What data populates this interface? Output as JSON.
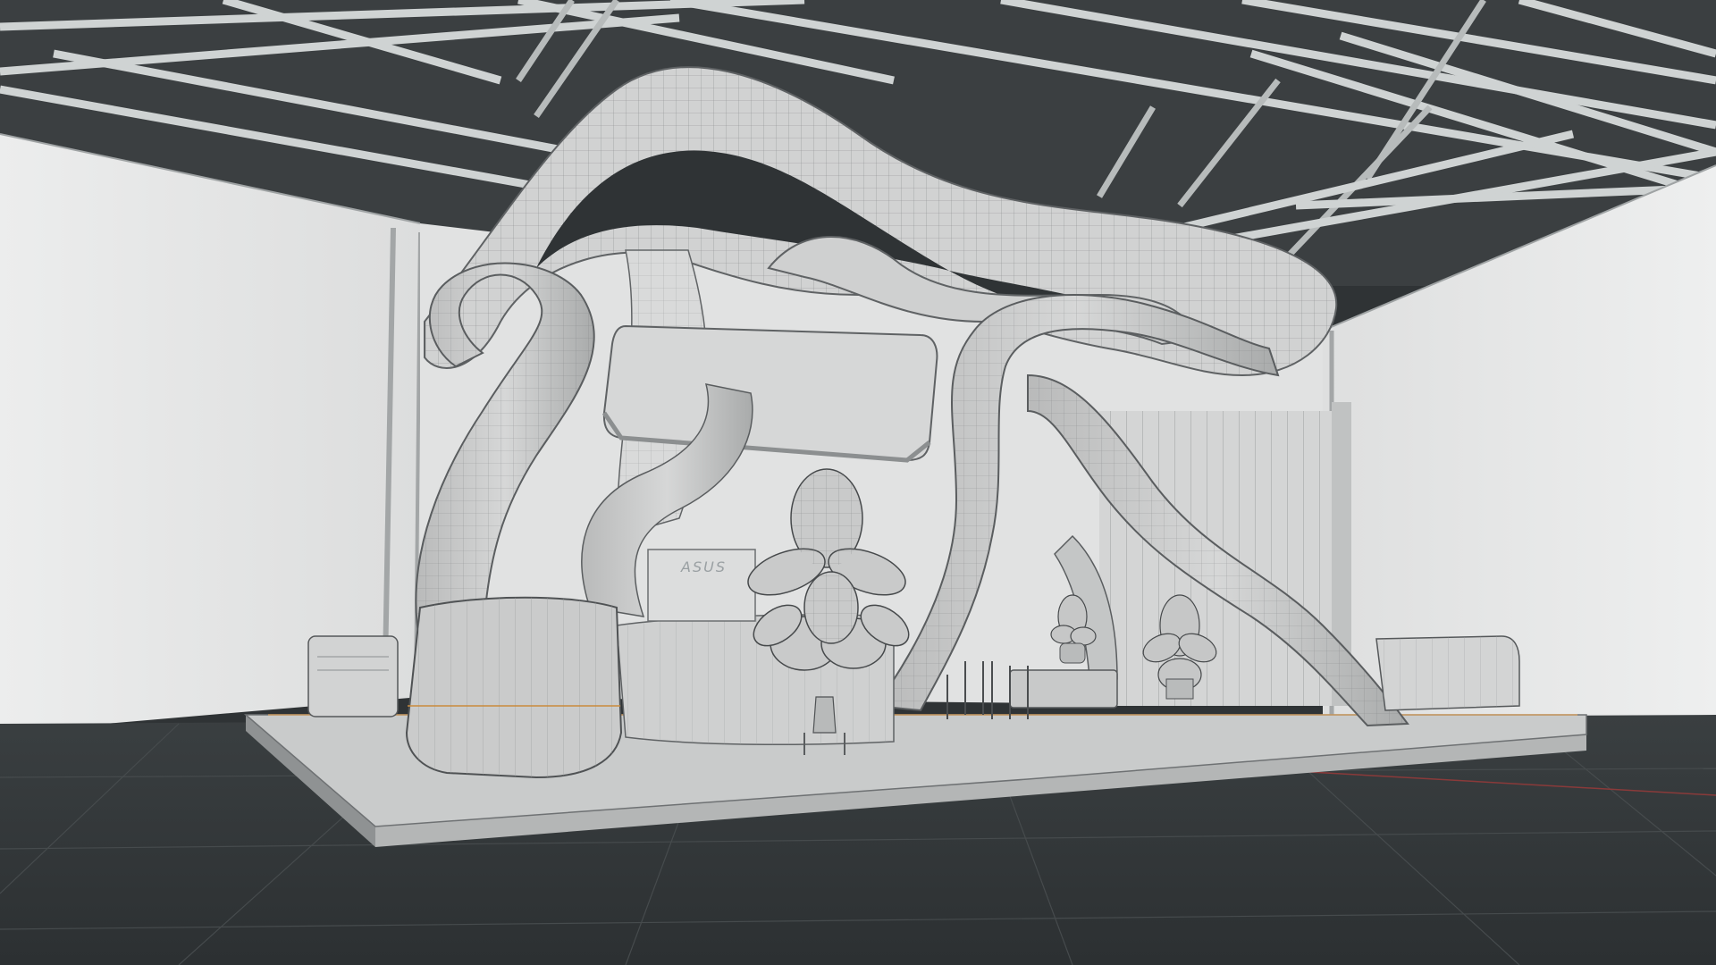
{
  "viewport": {
    "mode": "3d-viewport-wireframe-overlay",
    "background_color": "#2f3335",
    "floor_color": "#33383a",
    "wall_color": "#e6e7e7",
    "ceiling_color": "#3a3e40",
    "mesh_color": "#c9caca",
    "edge_color": "#5a5d5f"
  },
  "booth": {
    "logo_text": "ASUS"
  }
}
